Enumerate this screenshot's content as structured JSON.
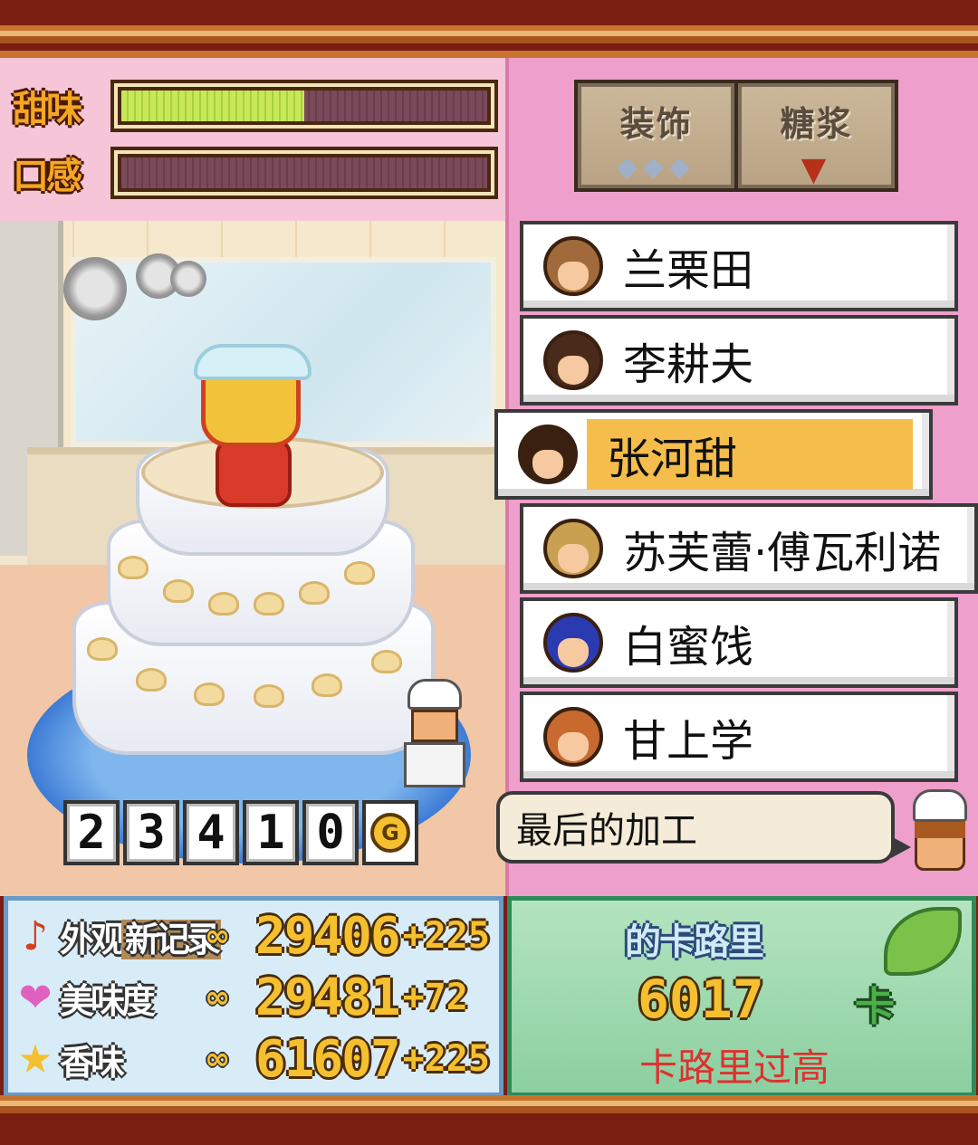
{
  "meters": [
    {
      "label": "甜味",
      "fill": 0.5
    },
    {
      "label": "口感",
      "fill": 0.0
    }
  ],
  "tools": [
    {
      "label": "装饰",
      "icon": "cream-drops-icon"
    },
    {
      "label": "糖浆",
      "icon": "sauce-drip-icon"
    }
  ],
  "staff": [
    {
      "name": "兰栗田",
      "hair_color": "#a06a3a",
      "selected": false
    },
    {
      "name": "李耕夫",
      "hair_color": "#4a2a1a",
      "selected": false
    },
    {
      "name": "张河甜",
      "hair_color": "#3a2010",
      "selected": true
    },
    {
      "name": "苏芙蕾·傅瓦利诺",
      "hair_color": "#c8a050",
      "selected": false
    },
    {
      "name": "白蜜饯",
      "hair_color": "#2a3ab0",
      "selected": false
    },
    {
      "name": "甘上学",
      "hair_color": "#c86a30",
      "selected": false
    }
  ],
  "gold": {
    "digits": [
      "2",
      "3",
      "4",
      "1",
      "0"
    ],
    "coin_letter": "G"
  },
  "speech": {
    "text": "最后的加工"
  },
  "stats": [
    {
      "icon": "♪",
      "icon_name": "music-note-icon",
      "label": "外观",
      "badge": "新记录",
      "inf": "∞",
      "value": "29406",
      "plus": "+225",
      "icon_color": "#d04020"
    },
    {
      "icon": "❤",
      "icon_name": "heart-icon",
      "label": "美味度",
      "badge": "",
      "inf": "∞",
      "value": "29481",
      "plus": "+72",
      "icon_color": "#e060c0"
    },
    {
      "icon": "★",
      "icon_name": "star-icon",
      "label": "香味",
      "badge": "",
      "inf": "∞",
      "value": "61607",
      "plus": "+225",
      "icon_color": "#f5c030"
    }
  ],
  "calories": {
    "title": "的卡路里",
    "value": "6017",
    "unit": "卡",
    "warning": "卡路里过高"
  }
}
